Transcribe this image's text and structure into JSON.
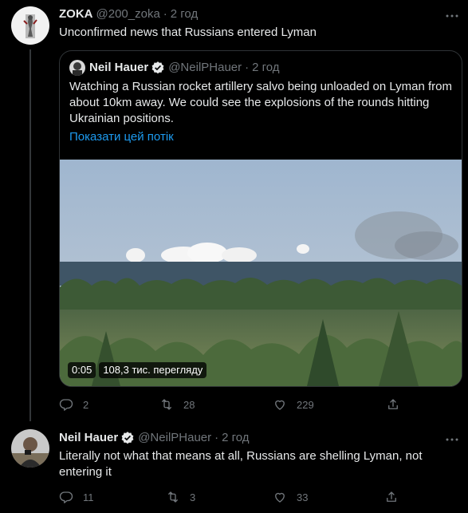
{
  "tweet1": {
    "name": "ZOKA",
    "handle": "@200_zoka",
    "separator": "·",
    "time": "2 год",
    "text": "Unconfirmed news that Russians entered Lyman",
    "more_icon": "more-horizontal-icon",
    "quote": {
      "name": "Neil Hauer",
      "handle": "@NeilPHauer",
      "separator": "·",
      "time": "2 год",
      "text": "Watching a Russian rocket artillery salvo being unloaded on Lyman from about 10km away. We could see the explosions of the rounds hitting Ukrainian positions.",
      "show_thread": "Показати цей потік",
      "video_time": "0:05",
      "video_views": "108,3 тис. перегляду"
    },
    "actions": {
      "replies": "2",
      "retweets": "28",
      "likes": "229"
    }
  },
  "tweet2": {
    "name": "Neil Hauer",
    "handle": "@NeilPHauer",
    "separator": "·",
    "time": "2 год",
    "text": "Literally not what that means at all, Russians are shelling Lyman, not entering it",
    "more_icon": "more-horizontal-icon",
    "actions": {
      "replies": "11",
      "retweets": "3",
      "likes": "33"
    }
  },
  "colors": {
    "background": "#000000",
    "text": "#e7e9ea",
    "secondary": "#71767b",
    "link": "#1d9bf0",
    "verified": "#1d9bf0",
    "border": "#2f3336"
  }
}
